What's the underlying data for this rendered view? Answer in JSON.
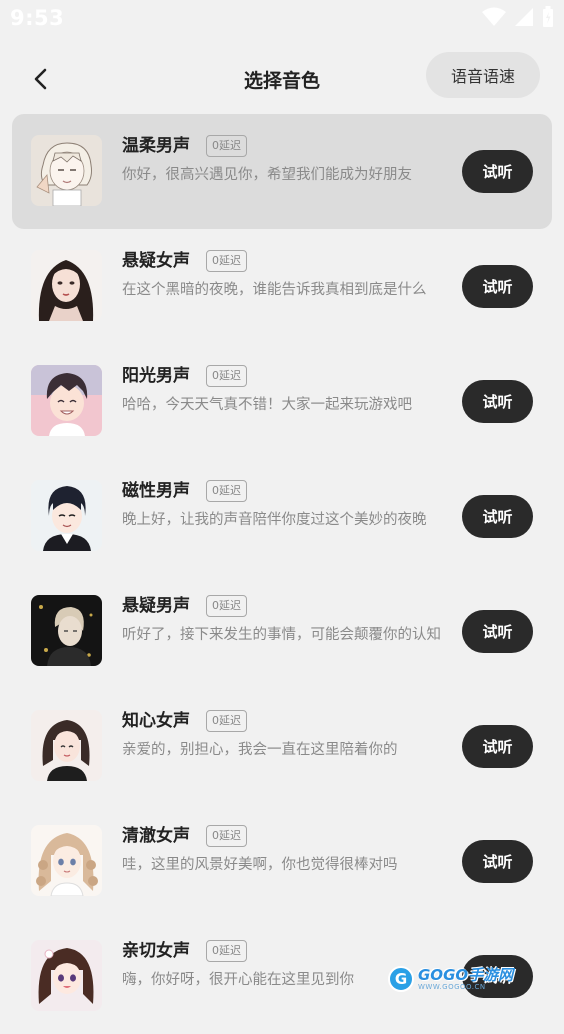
{
  "status_bar": {
    "time": "9:53",
    "icons": [
      "wifi-icon",
      "cell-signal-icon",
      "battery-icon"
    ]
  },
  "header": {
    "title": "选择音色",
    "speed_button_label": "语音语速",
    "back_icon": "chevron-left-icon"
  },
  "voices": [
    {
      "name": "温柔男声",
      "delay": "0延迟",
      "desc": "你好，很高兴遇见你，希望我们能成为好朋友",
      "button": "试听",
      "selected": true
    },
    {
      "name": "悬疑女声",
      "delay": "0延迟",
      "desc": "在这个黑暗的夜晚，谁能告诉我真相到底是什么",
      "button": "试听",
      "selected": false
    },
    {
      "name": "阳光男声",
      "delay": "0延迟",
      "desc": "哈哈，今天天气真不错！大家一起来玩游戏吧",
      "button": "试听",
      "selected": false
    },
    {
      "name": "磁性男声",
      "delay": "0延迟",
      "desc": "晚上好，让我的声音陪伴你度过这个美妙的夜晚",
      "button": "试听",
      "selected": false
    },
    {
      "name": "悬疑男声",
      "delay": "0延迟",
      "desc": "听好了，接下来发生的事情，可能会颠覆你的认知",
      "button": "试听",
      "selected": false
    },
    {
      "name": "知心女声",
      "delay": "0延迟",
      "desc": "亲爱的，别担心，我会一直在这里陪着你的",
      "button": "试听",
      "selected": false
    },
    {
      "name": "清澈女声",
      "delay": "0延迟",
      "desc": "哇，这里的风景好美啊，你也觉得很棒对吗",
      "button": "试听",
      "selected": false
    },
    {
      "name": "亲切女声",
      "delay": "0延迟",
      "desc": "嗨，你好呀，很开心能在这里见到你",
      "button": "试听",
      "selected": false
    }
  ],
  "watermark": {
    "logo_letter": "G",
    "main": "GOGO手游网",
    "sub": "WWW.GOGOO.CN"
  },
  "colors": {
    "background": "#f1f1f1",
    "selected_row": "#dcdcdc",
    "listen_button": "#2a2a2a",
    "speed_button": "#e3e3e3"
  }
}
